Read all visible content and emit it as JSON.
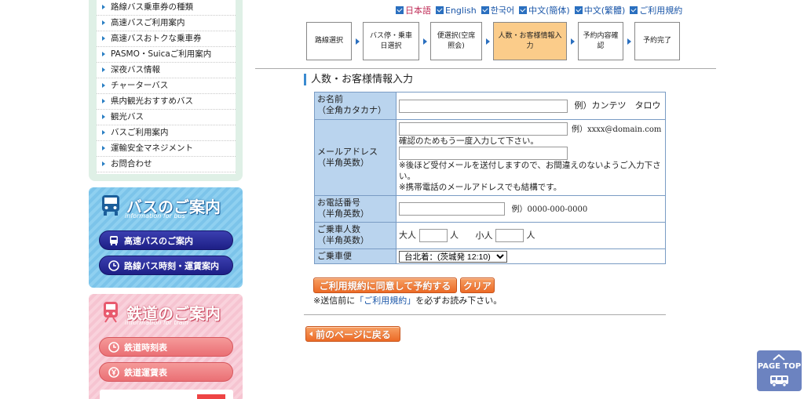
{
  "sidebar": {
    "menu_items": [
      "路線バス乗車券の種類",
      "高速バスご利用案内",
      "高速バスおトクな乗車券",
      "PASMO・Suicaご利用案内",
      "深夜バス情報",
      "チャーターバス",
      "県内観光おすすめバス",
      "観光バス",
      "バスご利用案内",
      "運輸安全マネジメント",
      "お問合わせ"
    ],
    "bus_box": {
      "title": "バスのご案内",
      "subtitle": "information for bus",
      "buttons": [
        "高速バスのご案内",
        "路線バス時刻・運賃案内"
      ]
    },
    "rail_box": {
      "title": "鉄道のご案内",
      "subtitle": "information for train",
      "buttons": [
        "鉄道時刻表",
        "鉄道運賃表"
      ]
    }
  },
  "language_links": [
    {
      "label": "日本語",
      "current": true
    },
    {
      "label": "English",
      "current": false
    },
    {
      "label": "한국어",
      "current": false
    },
    {
      "label": "中文(簡体)",
      "current": false
    },
    {
      "label": "中文(繁體)",
      "current": false
    },
    {
      "label": "ご利用規約",
      "current": false
    }
  ],
  "steps": [
    {
      "label": "路線選択",
      "active": false
    },
    {
      "label": "バス停・乗車日選択",
      "active": false
    },
    {
      "label": "便選択(空席照会)",
      "active": false
    },
    {
      "label": "人数・お客様情報入力",
      "active": true
    },
    {
      "label": "予約内容確認",
      "active": false
    },
    {
      "label": "予約完了",
      "active": false
    }
  ],
  "section_title": "人数・お客様情報入力",
  "form": {
    "name": {
      "label_line1": "お名前",
      "label_line2": "（全角カタカナ）",
      "value": "",
      "example": "例）カンテツ　タロウ"
    },
    "email": {
      "label_line1": "メールアドレス",
      "label_line2": "（半角英数）",
      "value": "",
      "example": "例）xxxx@domain.com",
      "confirm_text": "確認のためもう一度入力して下さい。",
      "confirm_value": "",
      "note1": "※後ほど受付メールを送付しますので、お間違えのないようご入力下さい。",
      "note2": "※携帯電話のメールアドレスでも結構です。"
    },
    "phone": {
      "label_line1": "お電話番号",
      "label_line2": "（半角英数）",
      "value": "",
      "example": "例）0000-000-0000"
    },
    "passengers": {
      "label_line1": "ご乗車人数",
      "label_line2": "（半角英数）",
      "adult_label": "大人",
      "adult_value": "",
      "child_label": "小人",
      "child_value": "",
      "unit": "人"
    },
    "trip": {
      "label": "ご乗車便",
      "selected": "台北着：(茨城発 12:10)"
    }
  },
  "buttons": {
    "agree": "ご利用規約に同意して予約する",
    "clear": "クリア",
    "back": "前のページに戻る"
  },
  "notice": {
    "prefix": "※送信前に",
    "link": "「ご利用規約」",
    "suffix": "を必ずお読み下さい。"
  },
  "page_top": "PAGE TOP",
  "colors": {
    "accent_blue": "#2a6fbf",
    "active_step": "#fbcc8a",
    "orange_button": "#ec6a26",
    "table_header": "#bad4ee"
  }
}
